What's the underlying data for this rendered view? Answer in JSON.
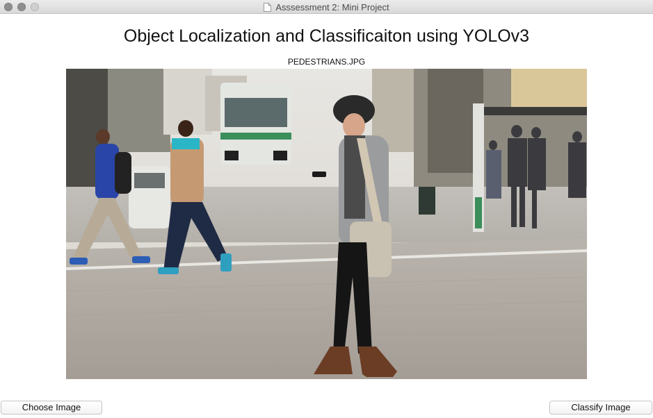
{
  "window": {
    "title": "Asssessment 2: Mini Project"
  },
  "main": {
    "heading": "Object Localization and Classificaiton using YOLOv3",
    "filename": "PEDESTRIANS.JPG",
    "image": {
      "description_icon": "photo-pedestrians-street"
    }
  },
  "buttons": {
    "choose_label": "Choose Image",
    "classify_label": "Classify Image"
  }
}
